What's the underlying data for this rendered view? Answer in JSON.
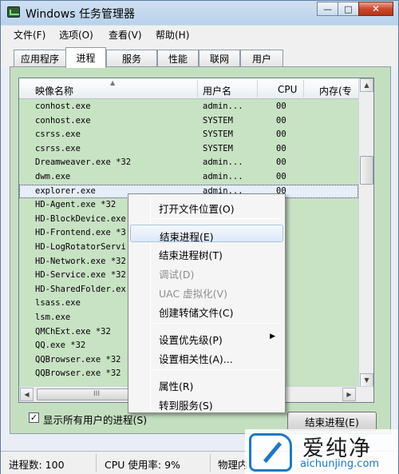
{
  "window": {
    "title": "Windows 任务管理器",
    "buttons": {
      "minimize": "—",
      "maximize": "□",
      "close": "✕"
    }
  },
  "menu": [
    "文件(F)",
    "选项(O)",
    "查看(V)",
    "帮助(H)"
  ],
  "tabs": [
    "应用程序",
    "进程",
    "服务",
    "性能",
    "联网",
    "用户"
  ],
  "active_tab": "进程",
  "columns": {
    "name": "映像名称",
    "user": "用户名",
    "cpu": "CPU",
    "memory": "内存(专"
  },
  "processes": [
    {
      "name": "conhost.exe",
      "user": "admin...",
      "cpu": "00"
    },
    {
      "name": "conhost.exe",
      "user": "SYSTEM",
      "cpu": "00"
    },
    {
      "name": "csrss.exe",
      "user": "SYSTEM",
      "cpu": "00"
    },
    {
      "name": "csrss.exe",
      "user": "SYSTEM",
      "cpu": "00"
    },
    {
      "name": "Dreamweaver.exe *32",
      "user": "admin...",
      "cpu": "00"
    },
    {
      "name": "dwm.exe",
      "user": "admin...",
      "cpu": "00"
    },
    {
      "name": "explorer.exe",
      "user": "admin...",
      "cpu": "00"
    },
    {
      "name": "HD-Agent.exe *32",
      "user": "",
      "cpu": ""
    },
    {
      "name": "HD-BlockDevice.exe",
      "user": "",
      "cpu": ""
    },
    {
      "name": "HD-Frontend.exe *3",
      "user": "",
      "cpu": ""
    },
    {
      "name": "HD-LogRotatorServi",
      "user": "",
      "cpu": ""
    },
    {
      "name": "HD-Network.exe *32",
      "user": "",
      "cpu": ""
    },
    {
      "name": "HD-Service.exe *32",
      "user": "",
      "cpu": ""
    },
    {
      "name": "HD-SharedFolder.ex",
      "user": "",
      "cpu": ""
    },
    {
      "name": "lsass.exe",
      "user": "",
      "cpu": ""
    },
    {
      "name": "lsm.exe",
      "user": "",
      "cpu": ""
    },
    {
      "name": "QMChExt.exe *32",
      "user": "",
      "cpu": ""
    },
    {
      "name": "QQ.exe *32",
      "user": "",
      "cpu": ""
    },
    {
      "name": "QQBrowser.exe *32",
      "user": "",
      "cpu": ""
    },
    {
      "name": "QQBrowser.exe *32",
      "user": "",
      "cpu": ""
    }
  ],
  "context_menu": {
    "items": [
      {
        "label": "打开文件位置(O)",
        "state": "normal"
      },
      {
        "label": "结束进程(E)",
        "state": "hover"
      },
      {
        "label": "结束进程树(T)",
        "state": "normal"
      },
      {
        "label": "调试(D)",
        "state": "disabled"
      },
      {
        "label": "UAC 虚拟化(V)",
        "state": "disabled"
      },
      {
        "label": "创建转储文件(C)",
        "state": "normal"
      },
      {
        "label": "设置优先级(P)",
        "state": "normal",
        "submenu": true
      },
      {
        "label": "设置相关性(A)...",
        "state": "normal"
      },
      {
        "label": "属性(R)",
        "state": "normal"
      },
      {
        "label": "转到服务(S)",
        "state": "normal"
      }
    ]
  },
  "show_all_users": {
    "label": "显示所有用户的进程(S)",
    "checked": true,
    "check_mark": "✓"
  },
  "end_process_button": "结束进程(E)",
  "status": {
    "processes": "进程数: 100",
    "cpu": "CPU 使用率: 9%",
    "memory": "物理内"
  },
  "watermark": {
    "title": "爱纯净",
    "url": "aichunjing.com"
  },
  "scroll_glyphs": {
    "up": "▲",
    "down": "▼",
    "left": "◀",
    "right": "▶",
    "grip": "III",
    "sort": "▲",
    "submenu": "▶"
  }
}
